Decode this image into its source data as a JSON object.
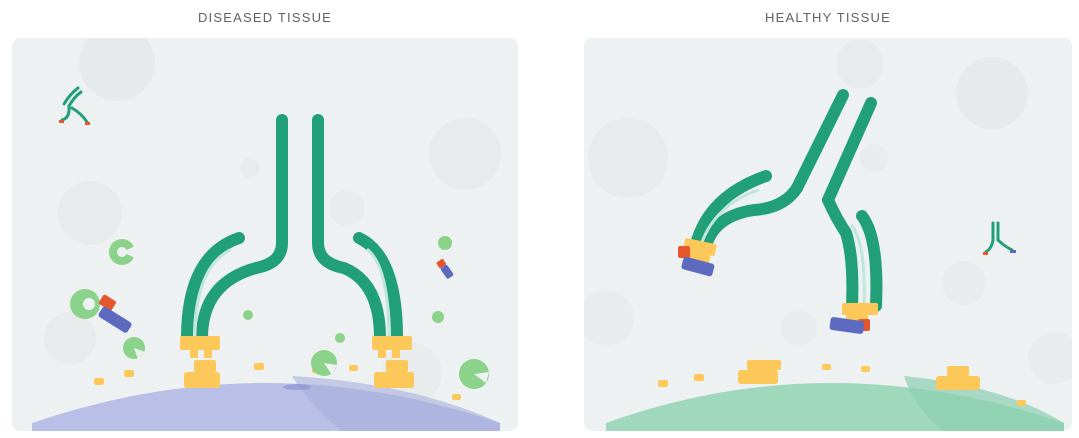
{
  "panels": {
    "diseased": {
      "title": "DISEASED TISSUE"
    },
    "healthy": {
      "title": "HEALTHY TISSUE"
    }
  },
  "colors": {
    "antibody_green": "#21a078",
    "antibody_light": "#bfe7da",
    "binding_yellow": "#fcc85a",
    "payload_red": "#e4572e",
    "payload_blue": "#5c6bc0",
    "target_green": "#8bd38a",
    "diseased_cell": "#b9bfe6",
    "healthy_cell": "#9fd8bd",
    "background_circle": "#e2e6e7"
  }
}
